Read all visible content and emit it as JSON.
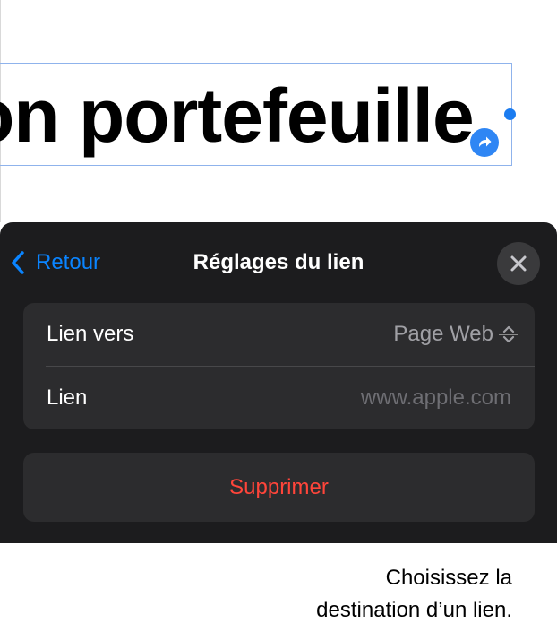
{
  "document": {
    "text_box_text": "on portefeuille"
  },
  "panel": {
    "back_label": "Retour",
    "title": "Réglages du lien",
    "rows": [
      {
        "label": "Lien vers",
        "value": "Page Web"
      },
      {
        "label": "Lien",
        "placeholder": "www.apple.com"
      }
    ],
    "delete_label": "Supprimer"
  },
  "callout": {
    "line1": "Choisissez la",
    "line2": "destination d’un lien."
  },
  "colors": {
    "accent": "#0a84ff",
    "destructive": "#ff453a",
    "panel_bg": "#1c1c1e",
    "group_bg": "#2c2c2e",
    "selection": "#1b7cf0"
  },
  "icons": {
    "back": "chevron-left-icon",
    "close": "close-icon",
    "link_badge": "link-arrow-icon",
    "value_picker": "chevron-up-down-icon"
  }
}
